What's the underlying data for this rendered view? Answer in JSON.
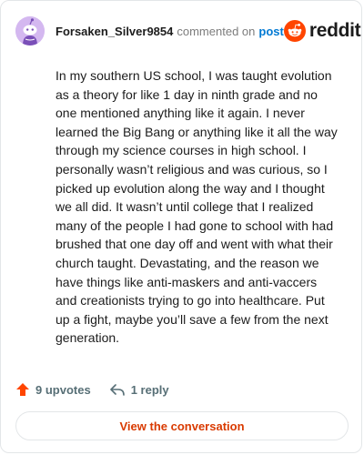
{
  "comment": {
    "username": "Forsaken_Silver9854",
    "commented_on_text": "commented on",
    "post_link_text": "post",
    "brand": "reddit",
    "body": "In my southern US school, I was taught evolution as a theory for like 1 day in ninth grade and no one mentioned anything like it again. I never learned the Big Bang or anything like it all the way through my science courses in high school. I personally wasn’t religious and was curious, so I picked up evolution along the way and I thought we all did. It wasn’t until college that I realized many of the people I had gone to school with had brushed that one day off and went with what their church taught. Devastating, and the reason we have things like anti-maskers and anti-vaccers and creationists trying to go into healthcare. Put up a fight, maybe you’ll save a few from the next generation.",
    "upvotes_label": "9 upvotes",
    "replies_label": "1 reply",
    "cta_label": "View the conversation"
  },
  "icons": {
    "avatar": "snoo-avatar",
    "brand_logo": "reddit-snoo-logo",
    "upvote": "upvote-arrow-icon",
    "reply": "reply-arrow-icon"
  },
  "colors": {
    "brand_orange": "#ff4500",
    "link_blue": "#0079d3",
    "cta_text": "#d93a00",
    "avatar_bg": "#d4b8f0"
  }
}
